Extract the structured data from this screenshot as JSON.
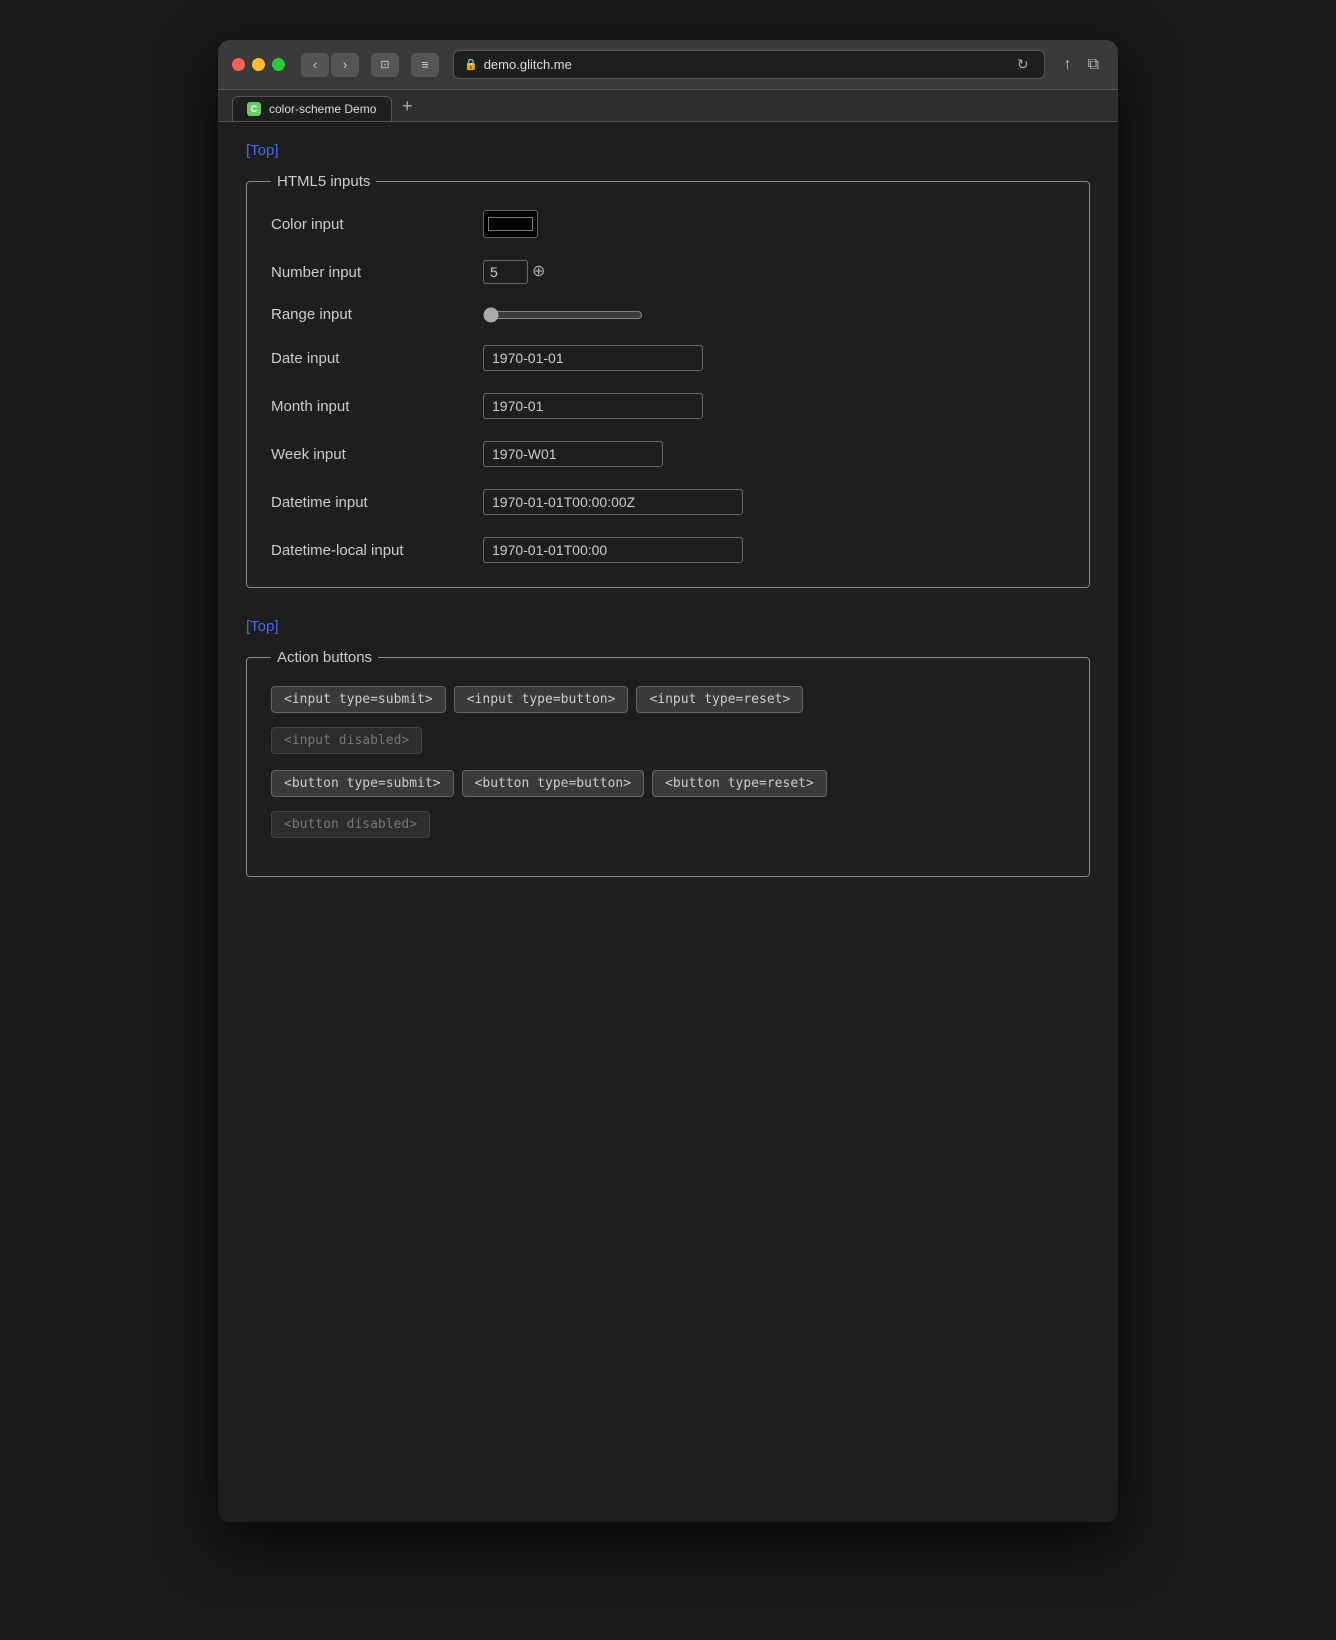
{
  "browser": {
    "url": "demo.glitch.me",
    "tab_label": "color-scheme Demo",
    "tab_favicon_letter": "C"
  },
  "nav": {
    "back_label": "‹",
    "forward_label": "›",
    "sidebar_icon": "⊡",
    "menu_icon": "≡",
    "reload_icon": "↻",
    "share_icon": "↑",
    "tabs_icon": "⧉",
    "new_tab_icon": "+"
  },
  "top_link": "[Top]",
  "html5_section": {
    "legend": "HTML5 inputs",
    "color_label": "Color input",
    "color_value": "#000000",
    "number_label": "Number input",
    "number_value": "5",
    "range_label": "Range input",
    "range_value": "0",
    "date_label": "Date input",
    "date_value": "1970-01-01",
    "month_label": "Month input",
    "month_value": "1970-01",
    "week_label": "Week input",
    "week_value": "1970-W01",
    "datetime_label": "Datetime input",
    "datetime_value": "1970-01-01T00:00:00Z",
    "datetime_local_label": "Datetime-local input",
    "datetime_local_value": "1970-01-01T00:00"
  },
  "bottom_link": "[Top]",
  "action_section": {
    "legend": "Action buttons",
    "buttons_row1": [
      "<input type=submit>",
      "<input type=button>",
      "<input type=reset>"
    ],
    "buttons_row1_disabled": "<input disabled>",
    "buttons_row2": [
      "<button type=submit>",
      "<button type=button>",
      "<button type=reset>"
    ],
    "buttons_row2_disabled": "<button disabled>"
  }
}
